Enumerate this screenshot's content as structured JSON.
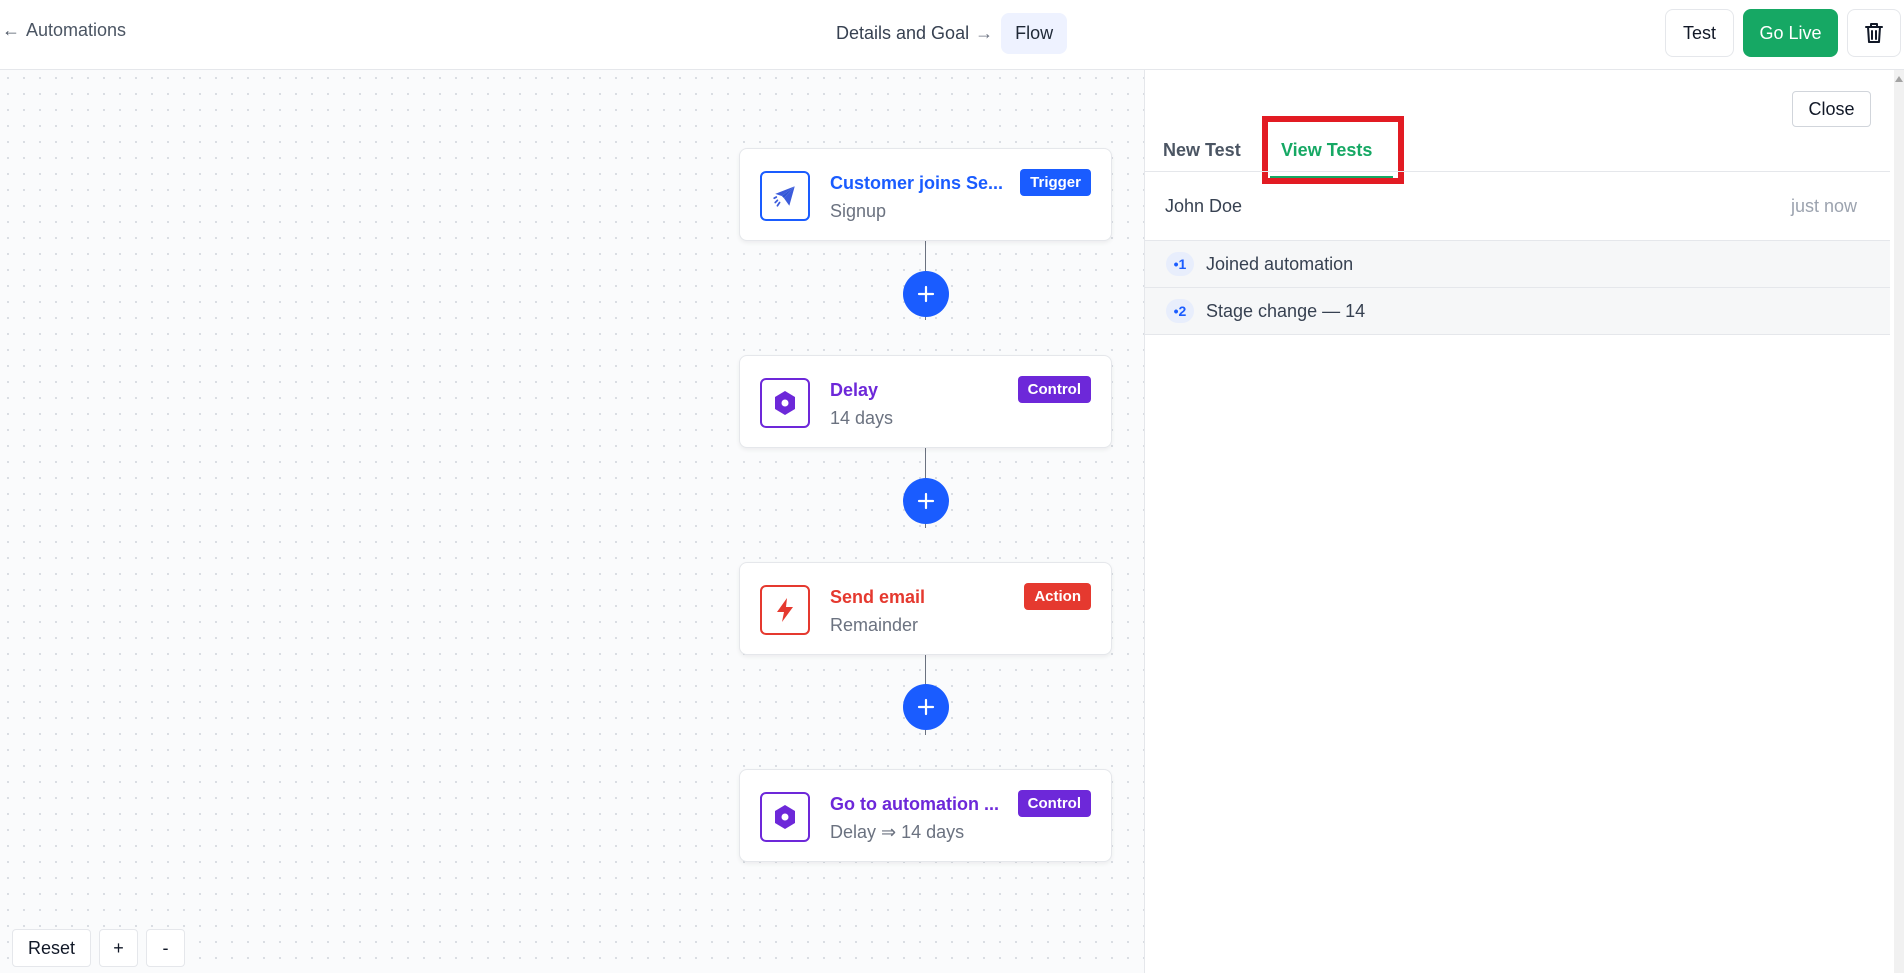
{
  "header": {
    "back_label": "Automations",
    "back_arrow": "←",
    "crumbs": {
      "first": "Details and Goal",
      "separator": "→",
      "current": "Flow"
    },
    "test_label": "Test",
    "go_live_label": "Go Live",
    "trash_icon": "trash-icon"
  },
  "flow": {
    "nodes": [
      {
        "title": "Customer joins Se...",
        "subtitle": "Signup",
        "badge": "Trigger",
        "icon": "paper-plane-icon",
        "color": "#1a5cff"
      },
      {
        "title": "Delay",
        "subtitle": "14 days",
        "badge": "Control",
        "icon": "hexagon-icon",
        "color": "#6d28d9"
      },
      {
        "title": "Send email",
        "subtitle": "Remainder",
        "badge": "Action",
        "icon": "lightning-icon",
        "color": "#e5392f"
      },
      {
        "title": "Go to automation ...",
        "subtitle": "Delay ⇒ 14 days",
        "badge": "Control",
        "icon": "hexagon-icon",
        "color": "#6d28d9"
      }
    ],
    "add_symbol": "+"
  },
  "zoom": {
    "reset_label": "Reset",
    "zoom_in_label": "+",
    "zoom_out_label": "-"
  },
  "panel": {
    "close_label": "Close",
    "tabs": {
      "new_test": "New Test",
      "view_tests": "View Tests"
    },
    "active_tab": "View Tests",
    "highlight_color": "#e21b23",
    "test": {
      "name": "John Doe",
      "time": "just now"
    },
    "steps": [
      {
        "number": "•1",
        "label": "Joined automation"
      },
      {
        "number": "•2",
        "label": "Stage change — 14"
      }
    ]
  },
  "colors": {
    "accent_blue": "#1a5cff",
    "go_live_green": "#16a864",
    "control_purple": "#6d28d9",
    "action_red": "#e5392f"
  }
}
